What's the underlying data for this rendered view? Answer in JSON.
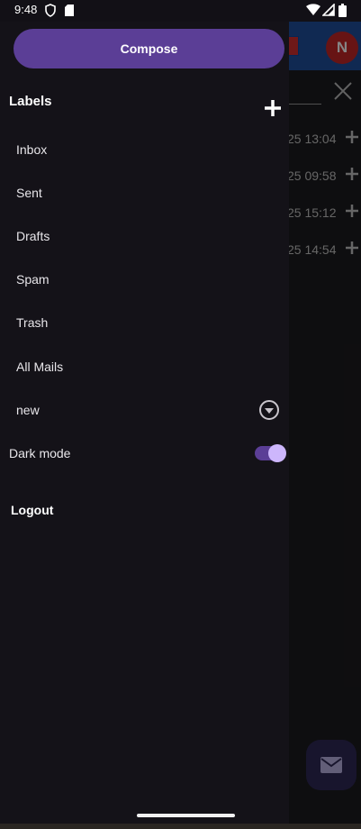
{
  "status_bar": {
    "time": "9:48",
    "left_icons": [
      "shield-icon",
      "sd-card-icon"
    ],
    "right_icons": [
      "wifi-icon",
      "signal-icon",
      "battery-icon"
    ]
  },
  "drawer": {
    "compose_label": "Compose",
    "labels_title": "Labels",
    "add_label_icon": "plus-icon",
    "labels": [
      "Inbox",
      "Sent",
      "Drafts",
      "Spam",
      "Trash",
      "All Mails",
      "new"
    ],
    "dark_mode_label": "Dark mode",
    "dark_mode_enabled": true,
    "logout_label": "Logout"
  },
  "background": {
    "avatar_letter": "N",
    "rows": [
      {
        "time": "25 13:04"
      },
      {
        "time": "25 09:58"
      },
      {
        "time": "25 15:12"
      },
      {
        "time": "25 14:54"
      }
    ]
  },
  "colors": {
    "accent": "#5b3e96",
    "drawer_bg": "#141218",
    "toggle_thumb": "#cdb6fc",
    "avatar_bg": "#c62828",
    "topbar_bg": "#1f4f9e"
  }
}
